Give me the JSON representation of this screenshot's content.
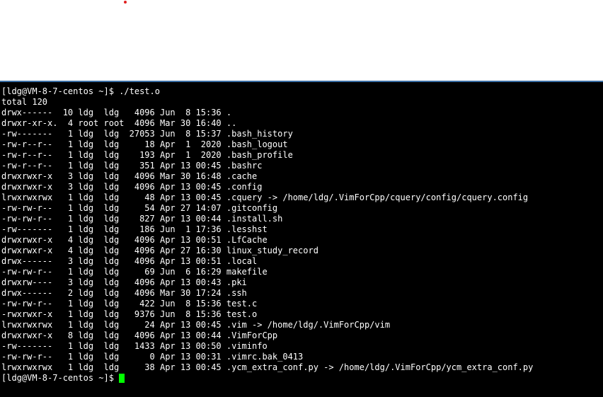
{
  "terminal": {
    "cursor_color": "#00ff00",
    "background": "#000000",
    "foreground": "#ffffff",
    "lines": [
      "[ldg@VM-8-7-centos ~]$ ./test.o",
      "total 120",
      "drwx------  10 ldg  ldg   4096 Jun  8 15:36 .",
      "drwxr-xr-x.  4 root root  4096 Mar 30 16:40 ..",
      "-rw-------   1 ldg  ldg  27053 Jun  8 15:37 .bash_history",
      "-rw-r--r--   1 ldg  ldg     18 Apr  1  2020 .bash_logout",
      "-rw-r--r--   1 ldg  ldg    193 Apr  1  2020 .bash_profile",
      "-rw-r--r--   1 ldg  ldg    351 Apr 13 00:45 .bashrc",
      "drwxrwxr-x   3 ldg  ldg   4096 Mar 30 16:48 .cache",
      "drwxrwxr-x   3 ldg  ldg   4096 Apr 13 00:45 .config",
      "lrwxrwxrwx   1 ldg  ldg     48 Apr 13 00:45 .cquery -> /home/ldg/.VimForCpp/cquery/config/cquery.config",
      "-rw-rw-r--   1 ldg  ldg     54 Apr 27 14:07 .gitconfig",
      "-rw-rw-r--   1 ldg  ldg    827 Apr 13 00:44 .install.sh",
      "-rw-------   1 ldg  ldg    186 Jun  1 17:36 .lesshst",
      "drwxrwxr-x   4 ldg  ldg   4096 Apr 13 00:51 .LfCache",
      "drwxrwxr-x   4 ldg  ldg   4096 Apr 27 16:30 linux_study_record",
      "drwx------   3 ldg  ldg   4096 Apr 13 00:51 .local",
      "-rw-rw-r--   1 ldg  ldg     69 Jun  6 16:29 makefile",
      "drwxrw----   3 ldg  ldg   4096 Apr 13 00:43 .pki",
      "drwx------   2 ldg  ldg   4096 Mar 30 17:24 .ssh",
      "-rw-rw-r--   1 ldg  ldg    422 Jun  8 15:36 test.c",
      "-rwxrwxr-x   1 ldg  ldg   9376 Jun  8 15:36 test.o",
      "lrwxrwxrwx   1 ldg  ldg     24 Apr 13 00:45 .vim -> /home/ldg/.VimForCpp/vim",
      "drwxrwxr-x   8 ldg  ldg   4096 Apr 13 00:44 .VimForCpp",
      "-rw-------   1 ldg  ldg   1433 Apr 13 00:50 .viminfo",
      "-rw-rw-r--   1 ldg  ldg      0 Apr 13 00:31 .vimrc.bak_0413",
      "lrwxrwxrwx   1 ldg  ldg     38 Apr 13 00:45 .ycm_extra_conf.py -> /home/ldg/.VimForCpp/ycm_extra_conf.py"
    ],
    "prompt": "[ldg@VM-8-7-centos ~]$ "
  }
}
